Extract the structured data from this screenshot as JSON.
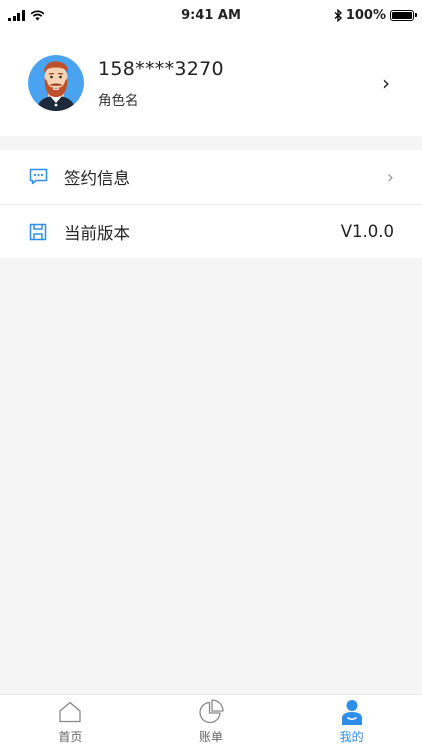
{
  "status_bar": {
    "time": "9:41 AM",
    "battery": "100%",
    "battery_level": 1.0
  },
  "profile": {
    "phone": "158****3270",
    "role": "角色名",
    "chevron": "›"
  },
  "menu": {
    "items": [
      {
        "label": "签约信息",
        "icon": "chat-bubble-icon",
        "chevron": "›"
      },
      {
        "label": "当前版本",
        "icon": "floppy-icon",
        "value": "V1.0.0"
      }
    ]
  },
  "tabbar": {
    "active_index": 2,
    "tabs": [
      {
        "label": "首页",
        "icon": "home-icon"
      },
      {
        "label": "账单",
        "icon": "pie-chart-icon"
      },
      {
        "label": "我的",
        "icon": "user-icon"
      }
    ]
  },
  "colors": {
    "accent": "#2e8ee9",
    "avatar_bg": "#4aa3f0",
    "page_bg": "#f5f5f5"
  }
}
